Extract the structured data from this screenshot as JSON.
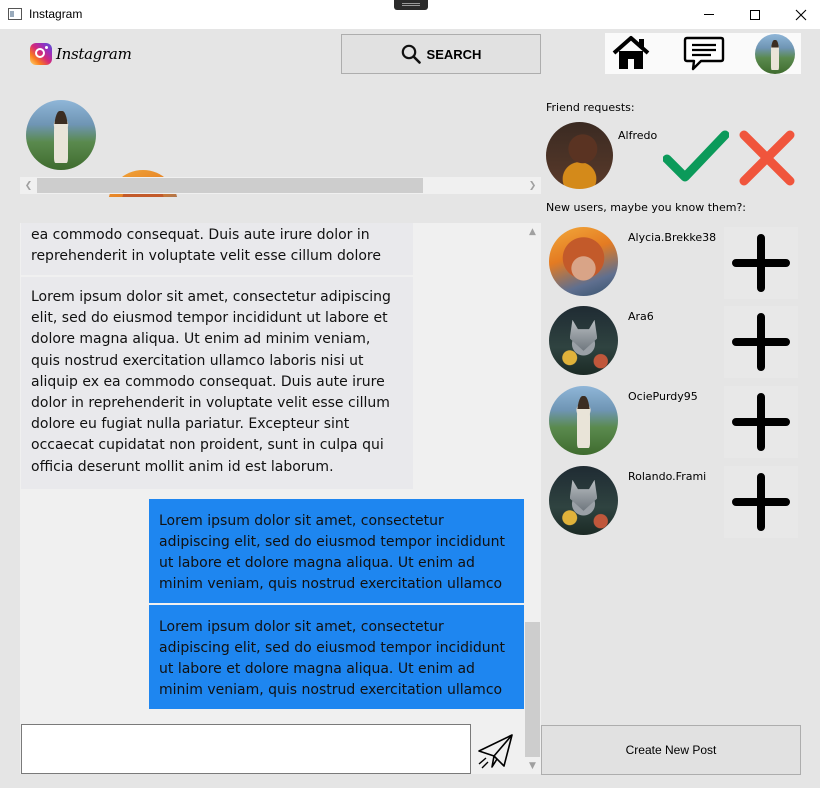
{
  "window": {
    "title": "Instagram",
    "controls": {
      "minimize": "minimize",
      "maximize": "maximize",
      "close": "close"
    }
  },
  "header": {
    "logo_text": "Instagram",
    "search_label": "SEARCH",
    "icons": {
      "search": "search-icon",
      "home": "home-icon",
      "messages": "chat-icon",
      "profile": "avatar"
    }
  },
  "stories": [
    {
      "avatar_style": "forest"
    },
    {
      "avatar_style": "autumn"
    },
    {
      "avatar_style": "wolf"
    },
    {
      "avatar_style": "forest"
    },
    {
      "avatar_style": "wolf"
    },
    {
      "avatar_style": "portrait"
    },
    {
      "avatar_style": "autumn"
    }
  ],
  "chat": {
    "messages_in": [
      "ea commodo consequat. Duis aute irure dolor in reprehenderit in voluptate velit esse cillum dolore",
      "Lorem ipsum dolor sit amet, consectetur adipiscing elit, sed do eiusmod tempor incididunt ut labore et dolore magna aliqua. Ut enim ad minim veniam, quis nostrud exercitation ullamco laboris nisi ut aliquip ex ea commodo consequat. Duis aute irure dolor in reprehenderit in voluptate velit esse cillum dolore eu fugiat nulla pariatur. Excepteur sint occaecat cupidatat non proident, sunt in culpa qui officia deserunt mollit anim id est laborum."
    ],
    "messages_out": [
      "Lorem ipsum dolor sit amet, consectetur adipiscing elit, sed do eiusmod tempor incididunt ut labore et dolore magna aliqua. Ut enim ad minim veniam, quis nostrud exercitation ullamco",
      "Lorem ipsum dolor sit amet, consectetur adipiscing elit, sed do eiusmod tempor incididunt ut labore et dolore magna aliqua. Ut enim ad minim veniam, quis nostrud exercitation ullamco"
    ],
    "input_value": "",
    "outgoing_color": "#1e86f0",
    "incoming_color": "#e9e9ec"
  },
  "friend_requests": {
    "label": "Friend requests:",
    "items": [
      {
        "name": "Alfredo",
        "avatar_style": "portrait"
      }
    ],
    "accept_color": "#0b9a5a",
    "decline_color": "#f0553c"
  },
  "suggestions": {
    "label": "New users, maybe you know them?:",
    "items": [
      {
        "name": "Alycia.Brekke38",
        "avatar_style": "autumn"
      },
      {
        "name": "Ara6",
        "avatar_style": "wolf"
      },
      {
        "name": "OciePurdy95",
        "avatar_style": "forest"
      },
      {
        "name": "Rolando.Frami",
        "avatar_style": "wolf"
      }
    ]
  },
  "create_post_label": "Create New Post"
}
